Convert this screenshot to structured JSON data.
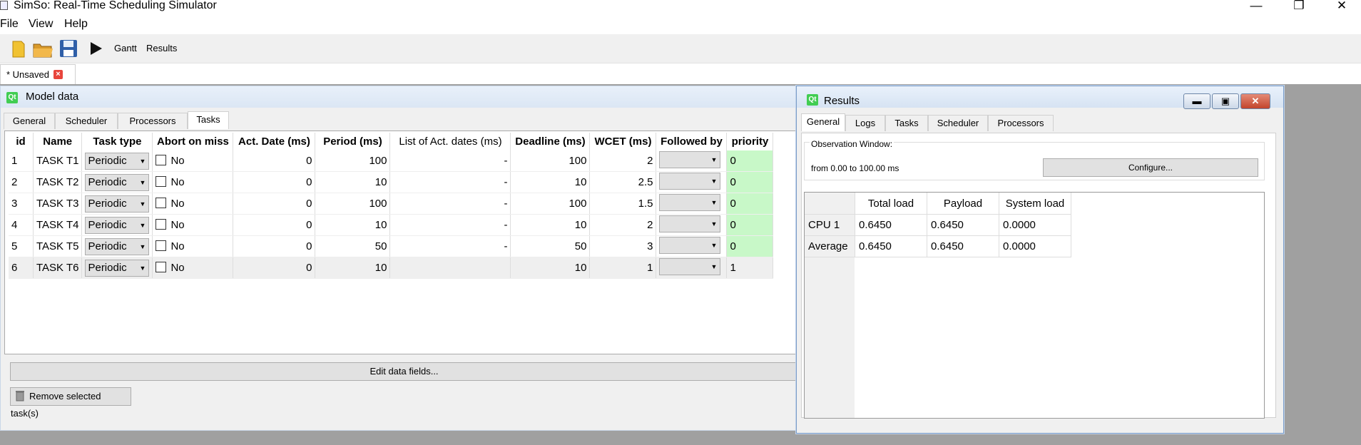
{
  "window": {
    "title": "SimSo: Real-Time Scheduling Simulator",
    "minimize": "—",
    "restore": "❐",
    "close": "✕"
  },
  "menu": [
    "File",
    "View",
    "Help"
  ],
  "toolbar": {
    "icons": [
      "new-file-icon",
      "open-folder-icon",
      "save-icon",
      "run-icon"
    ],
    "gantt": "Gantt",
    "results": "Results"
  },
  "doc_tab": {
    "label": "* Unsaved",
    "close": "×"
  },
  "model": {
    "title": "Model data",
    "qt": "Qt",
    "tabs": [
      "General",
      "Scheduler",
      "Processors",
      "Tasks"
    ],
    "active_tab": "Tasks",
    "columns": [
      "id",
      "Name",
      "Task type",
      "Abort on miss",
      "Act. Date (ms)",
      "Period (ms)",
      "List of Act. dates (ms)",
      "Deadline (ms)",
      "WCET (ms)",
      "Followed by",
      "priority"
    ],
    "rows": [
      {
        "id": "1",
        "name": "TASK T1",
        "type": "Periodic",
        "abort": "No",
        "act": "0",
        "period": "100",
        "list": "-",
        "deadline": "100",
        "wcet": "2",
        "followed": "",
        "priority": "0"
      },
      {
        "id": "2",
        "name": "TASK T2",
        "type": "Periodic",
        "abort": "No",
        "act": "0",
        "period": "10",
        "list": "-",
        "deadline": "10",
        "wcet": "2.5",
        "followed": "",
        "priority": "0"
      },
      {
        "id": "3",
        "name": "TASK T3",
        "type": "Periodic",
        "abort": "No",
        "act": "0",
        "period": "100",
        "list": "-",
        "deadline": "100",
        "wcet": "1.5",
        "followed": "",
        "priority": "0"
      },
      {
        "id": "4",
        "name": "TASK T4",
        "type": "Periodic",
        "abort": "No",
        "act": "0",
        "period": "10",
        "list": "-",
        "deadline": "10",
        "wcet": "2",
        "followed": "",
        "priority": "0"
      },
      {
        "id": "5",
        "name": "TASK T5",
        "type": "Periodic",
        "abort": "No",
        "act": "0",
        "period": "50",
        "list": "-",
        "deadline": "50",
        "wcet": "3",
        "followed": "",
        "priority": "0"
      },
      {
        "id": "6",
        "name": "TASK T6",
        "type": "Periodic",
        "abort": "No",
        "act": "0",
        "period": "10",
        "list": "",
        "deadline": "10",
        "wcet": "1",
        "followed": "",
        "priority": "1"
      }
    ],
    "edit_button": "Edit data fields...",
    "remove_button": "Remove selected task(s)"
  },
  "results": {
    "title": "Results",
    "qt": "Qt",
    "tabs": [
      "General",
      "Logs",
      "Tasks",
      "Scheduler",
      "Processors"
    ],
    "active_tab": "General",
    "observation_label": "Observation Window:",
    "observation_text": "from 0.00 to 100.00 ms",
    "configure_button": "Configure...",
    "load_columns": [
      "Total load",
      "Payload",
      "System load"
    ],
    "load_rows": [
      {
        "label": "CPU 1",
        "values": [
          "0.6450",
          "0.6450",
          "0.0000"
        ]
      },
      {
        "label": "Average",
        "values": [
          "0.6450",
          "0.6450",
          "0.0000"
        ]
      }
    ]
  },
  "colors": {
    "priority_highlight": "#c8f8c8",
    "close_red": "#c2442c",
    "mdi_background": "#a0a0a0"
  }
}
